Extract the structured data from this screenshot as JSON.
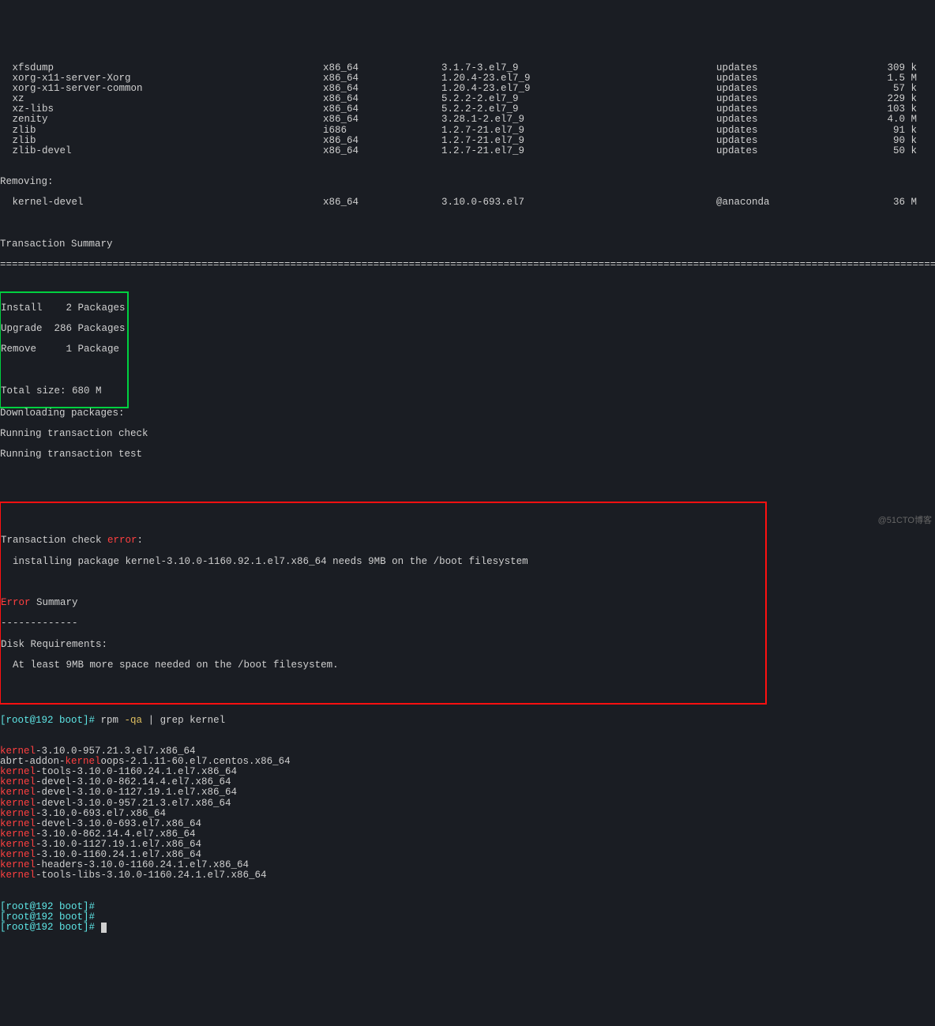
{
  "packages": [
    {
      "name": " xfsdump",
      "arch": "x86_64",
      "ver": "3.1.7-3.el7_9",
      "repo": "updates",
      "size": "309 k"
    },
    {
      "name": " xorg-x11-server-Xorg",
      "arch": "x86_64",
      "ver": "1.20.4-23.el7_9",
      "repo": "updates",
      "size": "1.5 M"
    },
    {
      "name": " xorg-x11-server-common",
      "arch": "x86_64",
      "ver": "1.20.4-23.el7_9",
      "repo": "updates",
      "size": "57 k"
    },
    {
      "name": " xz",
      "arch": "x86_64",
      "ver": "5.2.2-2.el7_9",
      "repo": "updates",
      "size": "229 k"
    },
    {
      "name": " xz-libs",
      "arch": "x86_64",
      "ver": "5.2.2-2.el7_9",
      "repo": "updates",
      "size": "103 k"
    },
    {
      "name": " zenity",
      "arch": "x86_64",
      "ver": "3.28.1-2.el7_9",
      "repo": "updates",
      "size": "4.0 M"
    },
    {
      "name": " zlib",
      "arch": "i686",
      "ver": "1.2.7-21.el7_9",
      "repo": "updates",
      "size": "91 k"
    },
    {
      "name": " zlib",
      "arch": "x86_64",
      "ver": "1.2.7-21.el7_9",
      "repo": "updates",
      "size": "90 k"
    },
    {
      "name": " zlib-devel",
      "arch": "x86_64",
      "ver": "1.2.7-21.el7_9",
      "repo": "updates",
      "size": "50 k"
    }
  ],
  "removing_label": "Removing:",
  "removing": {
    "name": " kernel-devel",
    "arch": "x86_64",
    "ver": "3.10.0-693.el7",
    "repo": "@anaconda",
    "size": "36 M"
  },
  "ts_header": "Transaction Summary",
  "separator": "============================================================================================================================================================================",
  "summary": {
    "install": "Install    2 Packages",
    "upgrade": "Upgrade  286 Packages",
    "remove": "Remove     1 Package",
    "total": "Total size: 680 M"
  },
  "download": "Downloading packages:",
  "check": "Running transaction check",
  "test": "Running transaction test",
  "err_block": {
    "l1a": "Transaction check ",
    "l1b": "error",
    "l1c": ":",
    "l2": "  installing package kernel-3.10.0-1160.92.1.el7.x86_64 needs 9MB on the /boot filesystem",
    "l3a": "Error",
    "l3b": " Summary",
    "l4": "-------------",
    "l5": "Disk Requirements:",
    "l6": "  At least 9MB more space needed on the /boot filesystem."
  },
  "prompt": {
    "user": "[root@192 boot]#",
    "cmd1": " rpm ",
    "flag": "-qa",
    "pipe": " | grep kernel"
  },
  "rpm_lines": [
    {
      "pre": "kernel",
      "post": "-3.10.0-957.21.3.el7.x86_64"
    },
    {
      "prefix": "abrt-addon-",
      "pre": "kernel",
      "post": "oops-2.1.11-60.el7.centos.x86_64"
    },
    {
      "pre": "kernel",
      "post": "-tools-3.10.0-1160.24.1.el7.x86_64"
    },
    {
      "pre": "kernel",
      "post": "-devel-3.10.0-862.14.4.el7.x86_64"
    },
    {
      "pre": "kernel",
      "post": "-devel-3.10.0-1127.19.1.el7.x86_64"
    },
    {
      "pre": "kernel",
      "post": "-devel-3.10.0-957.21.3.el7.x86_64"
    },
    {
      "pre": "kernel",
      "post": "-3.10.0-693.el7.x86_64"
    },
    {
      "pre": "kernel",
      "post": "-devel-3.10.0-693.el7.x86_64"
    },
    {
      "pre": "kernel",
      "post": "-3.10.0-862.14.4.el7.x86_64"
    },
    {
      "pre": "kernel",
      "post": "-3.10.0-1127.19.1.el7.x86_64"
    },
    {
      "pre": "kernel",
      "post": "-3.10.0-1160.24.1.el7.x86_64"
    },
    {
      "pre": "kernel",
      "post": "-headers-3.10.0-1160.24.1.el7.x86_64"
    },
    {
      "pre": "kernel",
      "post": "-tools-libs-3.10.0-1160.24.1.el7.x86_64"
    }
  ],
  "empty_prompts": 3,
  "watermark": "@51CTO博客"
}
